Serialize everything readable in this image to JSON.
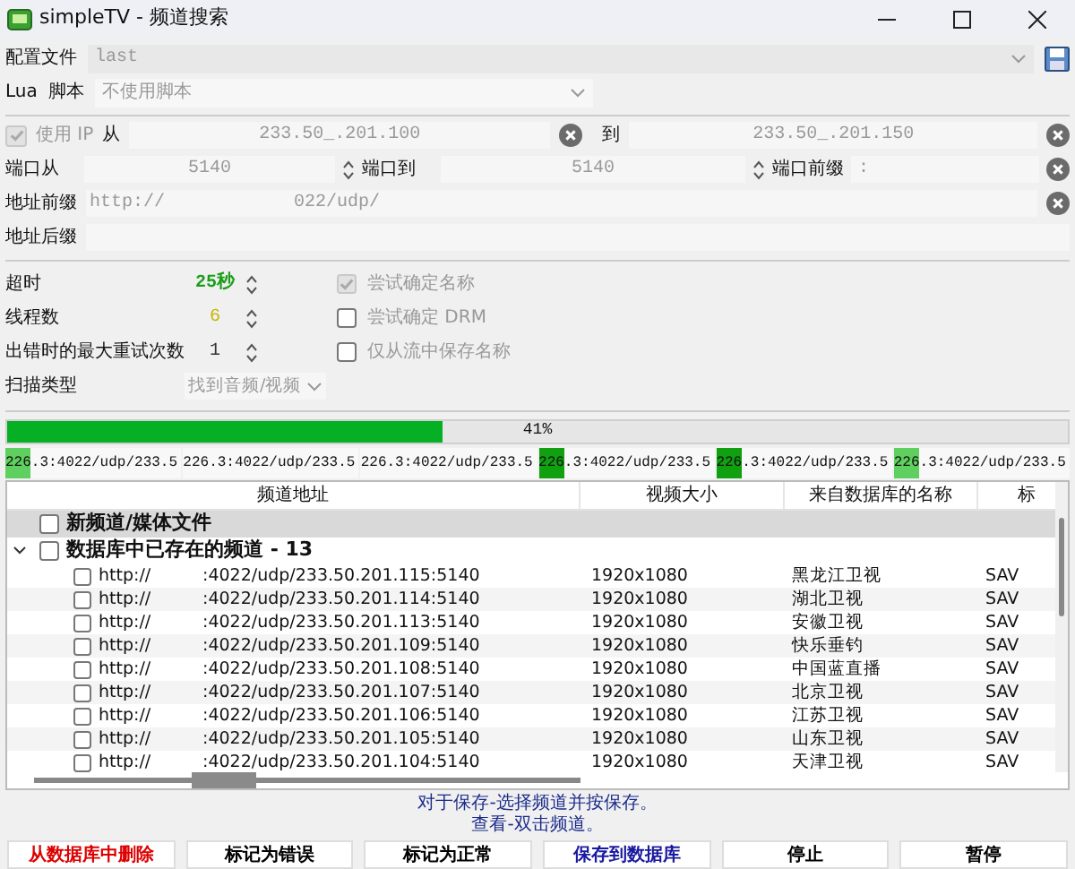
{
  "window": {
    "title": "simpleTV - 频道搜索"
  },
  "config": {
    "label": "配置文件",
    "value": "last"
  },
  "lua": {
    "label_1": "Lua",
    "label_2": "脚本",
    "value": "不使用脚本"
  },
  "ip": {
    "use_ip_checked": true,
    "use_ip_label": "使用 IP",
    "from_label": "从",
    "from_value": "233.50_.201.100",
    "to_label": "到",
    "to_value": "233.50_.201.150"
  },
  "ports": {
    "from_label": "端口从",
    "from_value": "5140",
    "to_label": "端口到",
    "to_value": "5140",
    "prefix_label": "端口前缀",
    "prefix_value": ":"
  },
  "address_prefix": {
    "label": "地址前缀",
    "value_1": "http://",
    "value_2": "022/udp/"
  },
  "address_suffix": {
    "label": "地址后缀"
  },
  "settings": [
    {
      "label": "超时",
      "value": "25秒",
      "color": "#1a9e1a"
    },
    {
      "label": "线程数",
      "value": "6",
      "color": "#c8b400"
    },
    {
      "label": "出错时的最大重试次数",
      "value": "1",
      "color": "#333333"
    }
  ],
  "options": [
    {
      "label": "尝试确定名称",
      "checked": true,
      "disabled": true
    },
    {
      "label": "尝试确定 DRM",
      "checked": false,
      "disabled": false
    },
    {
      "label": "仅从流中保存名称",
      "checked": false,
      "disabled": false
    }
  ],
  "scan_type": {
    "label": "扫描类型",
    "value": "找到音频/视频"
  },
  "progress": {
    "level": 0.41,
    "label": "41%"
  },
  "streams": [
    {
      "text": "226.3:4022/udp/233.5",
      "color": "#5fcf5f"
    },
    {
      "text": "226.3:4022/udp/233.5"
    },
    {
      "text": "226.3:4022/udp/233.5"
    },
    {
      "text": "226.3:4022/udp/233.5",
      "color": "#10a010"
    },
    {
      "text": "226.3:4022/udp/233.5",
      "color": "#10a010"
    },
    {
      "text": "226.3:4022/udp/233.5",
      "color": "#5fcf5f"
    }
  ],
  "table": {
    "columns": [
      "频道地址",
      "视频大小",
      "来自数据库的名称",
      "标"
    ],
    "groups": [
      {
        "label": "新频道/媒体文件",
        "expanded": false,
        "checked": false,
        "selected": true
      },
      {
        "label": "数据库中已存在的频道 - 13",
        "expanded": true,
        "checked": false,
        "selected": false,
        "rows": [
          {
            "prefix": "http://",
            "address": ":4022/udp/233.50.201.115:5140",
            "size": "1920x1080",
            "name": "黑龙江卫视",
            "tag": "SAV",
            "checked": false
          },
          {
            "prefix": "http://",
            "address": ":4022/udp/233.50.201.114:5140",
            "size": "1920x1080",
            "name": "湖北卫视",
            "tag": "SAV",
            "checked": false
          },
          {
            "prefix": "http://",
            "address": ":4022/udp/233.50.201.113:5140",
            "size": "1920x1080",
            "name": "安徽卫视",
            "tag": "SAV",
            "checked": false
          },
          {
            "prefix": "http://",
            "address": ":4022/udp/233.50.201.109:5140",
            "size": "1920x1080",
            "name": "快乐垂钓",
            "tag": "SAV",
            "checked": false
          },
          {
            "prefix": "http://",
            "address": ":4022/udp/233.50.201.108:5140",
            "size": "1920x1080",
            "name": "中国蓝直播",
            "tag": "SAV",
            "checked": false
          },
          {
            "prefix": "http://",
            "address": ":4022/udp/233.50.201.107:5140",
            "size": "1920x1080",
            "name": "北京卫视",
            "tag": "SAV",
            "checked": false
          },
          {
            "prefix": "http://",
            "address": ":4022/udp/233.50.201.106:5140",
            "size": "1920x1080",
            "name": "江苏卫视",
            "tag": "SAV",
            "checked": false
          },
          {
            "prefix": "http://",
            "address": ":4022/udp/233.50.201.105:5140",
            "size": "1920x1080",
            "name": "山东卫视",
            "tag": "SAV",
            "checked": false
          },
          {
            "prefix": "http://",
            "address": ":4022/udp/233.50.201.104:5140",
            "size": "1920x1080",
            "name": "天津卫视",
            "tag": "SAV",
            "checked": false
          }
        ]
      }
    ]
  },
  "hints": [
    "对于保存-选择频道并按保存。",
    "查看-双击频道。"
  ],
  "buttons": [
    {
      "label": "从数据库中删除",
      "color": "#dd0000"
    },
    {
      "label": "标记为错误",
      "color": "#000000"
    },
    {
      "label": "标记为正常",
      "color": "#000000"
    },
    {
      "label": "保存到数据库",
      "color": "#1a1aa0"
    },
    {
      "label": "停止",
      "color": "#000000"
    },
    {
      "label": "暂停",
      "color": "#000000"
    }
  ]
}
